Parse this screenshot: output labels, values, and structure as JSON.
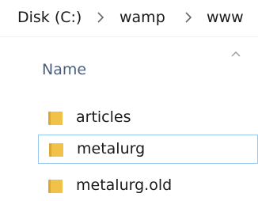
{
  "breadcrumb": {
    "items": [
      "Disk (C:)",
      "wamp",
      "www"
    ]
  },
  "column_header": {
    "name_label": "Name",
    "sort_direction": "ascending"
  },
  "files": [
    {
      "name": "articles",
      "type": "folder",
      "focused": false
    },
    {
      "name": "metalurg",
      "type": "folder",
      "focused": true
    },
    {
      "name": "metalurg.old",
      "type": "folder",
      "focused": false
    }
  ],
  "colors": {
    "folder_body": "#f0c24a",
    "folder_tab": "#dca82f",
    "focus_border": "#99c9ef",
    "header_text": "#4c607a"
  }
}
